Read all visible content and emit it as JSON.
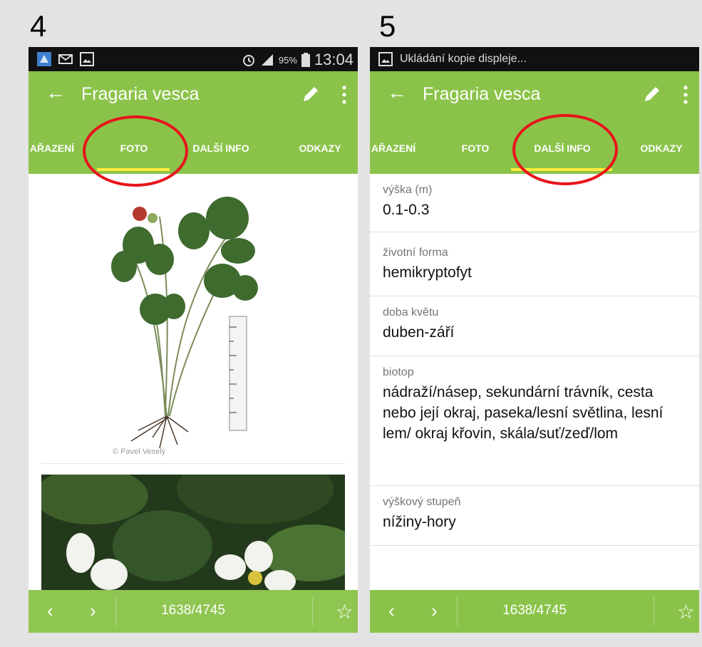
{
  "labels": {
    "left": "4",
    "right": "5"
  },
  "left_screen": {
    "status_bar": {
      "battery_percent": "95%",
      "time": "13:04"
    },
    "app_bar": {
      "title": "Fragaria vesca"
    },
    "tabs": [
      {
        "label": "ZAŘAZENÍ",
        "display": "AŘAZENÍ"
      },
      {
        "label": "FOTO",
        "selected": true
      },
      {
        "label": "DALŠÍ INFO"
      },
      {
        "label": "ODKAZY"
      }
    ],
    "photos": [
      {
        "caption": "© Pavel Veselý"
      }
    ],
    "bottom_bar": {
      "counter": "1638/4745"
    }
  },
  "right_screen": {
    "status_bar": {
      "notification": "Ukládání kopie displeje..."
    },
    "app_bar": {
      "title": "Fragaria vesca"
    },
    "tabs": [
      {
        "label": "ZAŘAZENÍ",
        "display": "AŘAZENÍ"
      },
      {
        "label": "FOTO"
      },
      {
        "label": "DALŠÍ INFO",
        "selected": true
      },
      {
        "label": "ODKAZY"
      }
    ],
    "info": [
      {
        "label": "výška (m)",
        "value": "0.1-0.3"
      },
      {
        "label": "životní forma",
        "value": "hemikryptofyt"
      },
      {
        "label": "doba květu",
        "value": "duben-září"
      },
      {
        "label": "biotop",
        "value": "nádraží/násep, sekundární trávník, cesta nebo její okraj, paseka/lesní světlina, lesní lem/ okraj křovin, skála/suť/zeď/lom"
      },
      {
        "label": "výškový stupeň",
        "value": "nížiny-hory"
      }
    ],
    "bottom_bar": {
      "counter": "1638/4745"
    }
  },
  "colors": {
    "primary": "#8bc34a",
    "indicator": "#ffeb3b",
    "highlight_circle": "#e8141c",
    "status_bar": "#111111"
  },
  "icons": [
    "back-arrow-icon",
    "pencil-icon",
    "more-vert-icon",
    "chevron-left-icon",
    "chevron-right-icon",
    "star-outline-icon",
    "alarm-icon",
    "signal-icon",
    "battery-icon",
    "screenshot-icon",
    "email-icon",
    "app-icon"
  ]
}
